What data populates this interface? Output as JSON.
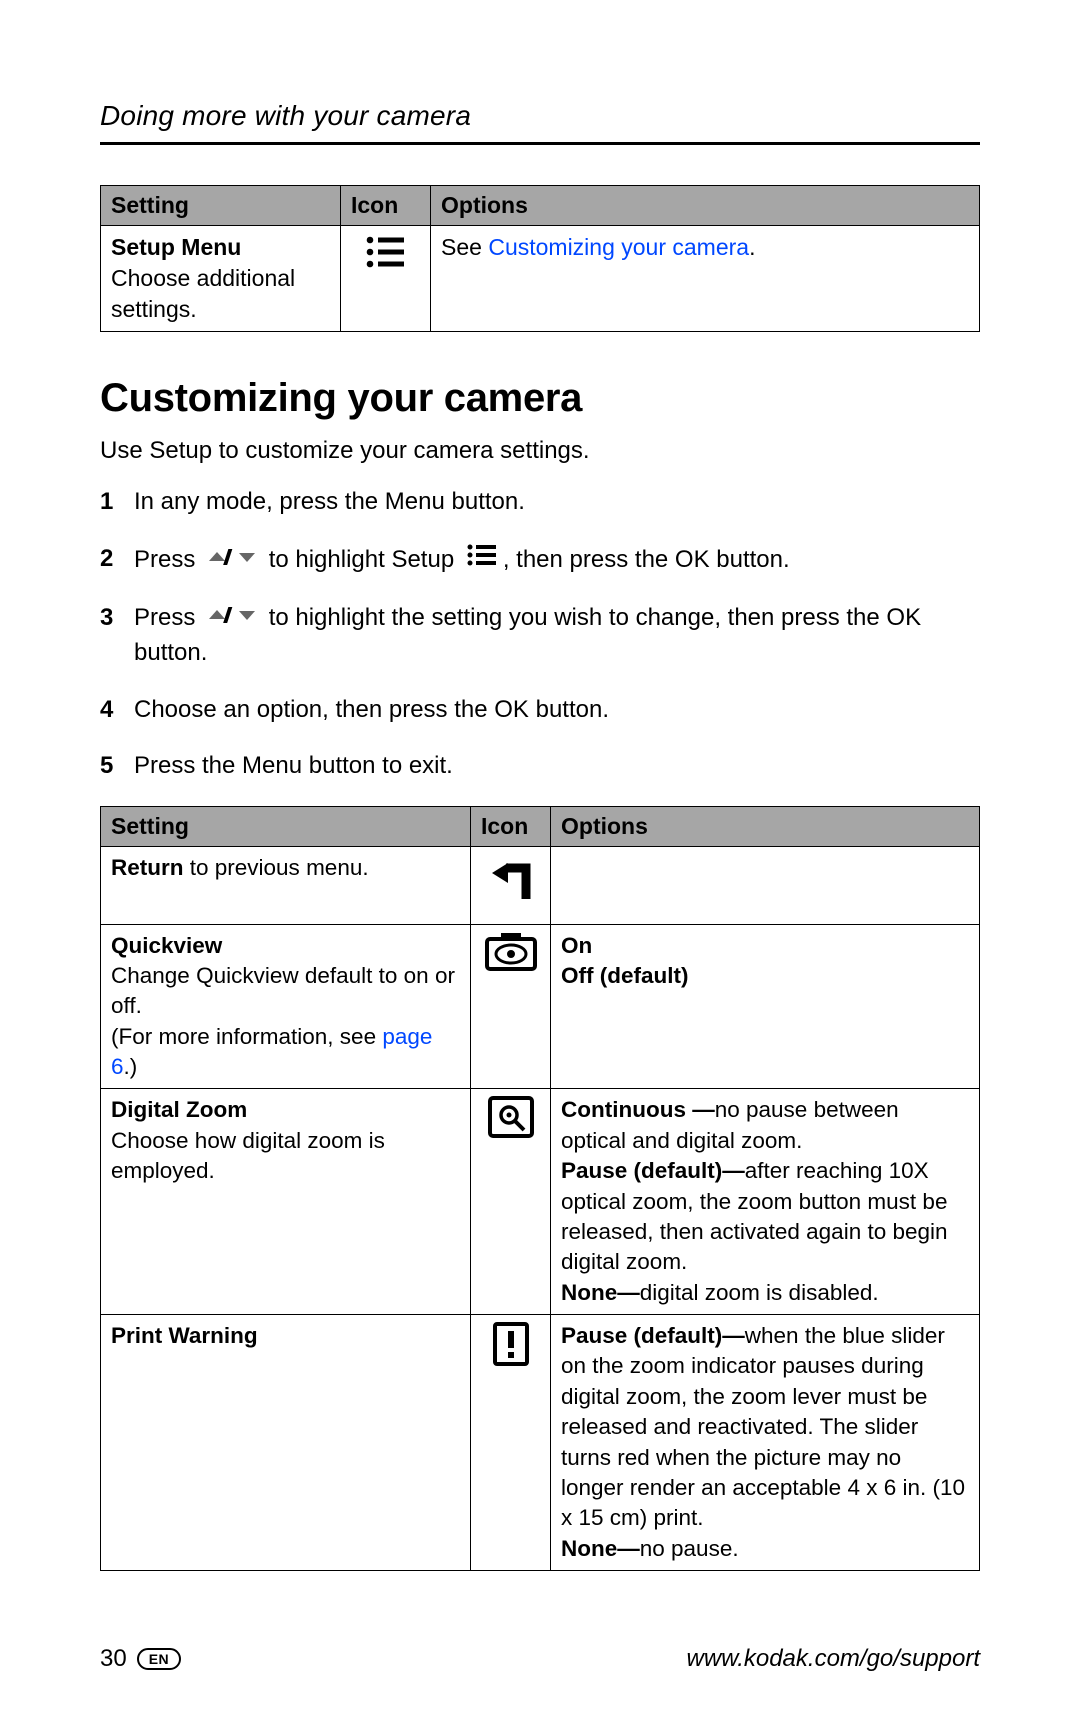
{
  "header": {
    "title": "Doing more with your camera"
  },
  "table1": {
    "headers": {
      "c1": "Setting",
      "c2": "Icon",
      "c3": "Options"
    },
    "row": {
      "settingTitle": "Setup Menu",
      "settingDesc": "Choose additional settings.",
      "optionsPrefix": "See ",
      "optionsLink": "Customizing your camera",
      "optionsSuffix": "."
    }
  },
  "section": {
    "heading": "Customizing your camera",
    "intro": "Use Setup to customize your camera settings.",
    "steps": {
      "s1": "In any mode, press the Menu button.",
      "s2a": "Press ",
      "s2b": " to highlight Setup ",
      "s2c": ", then press the OK button.",
      "s3a": "Press ",
      "s3b": " to highlight the setting you wish to change, then press the OK button.",
      "s4": "Choose an option, then press the OK button.",
      "s5": "Press the Menu button to exit."
    }
  },
  "table2": {
    "headers": {
      "c1": "Setting",
      "c2": "Icon",
      "c3": "Options"
    },
    "rows": {
      "return": {
        "titleBold": "Return",
        "titleRest": " to previous menu."
      },
      "quickview": {
        "title": "Quickview",
        "desc1": "Change Quickview default to on or off.",
        "desc2a": "(For more information, see ",
        "desc2link": "page 6",
        "desc2b": ".)",
        "opt1": "On",
        "opt2": "Off (default)"
      },
      "dz": {
        "title": "Digital Zoom",
        "desc": "Choose how digital zoom is employed.",
        "o1b": "Continuous —",
        "o1r": "no pause between optical and digital zoom.",
        "o2b": "Pause (default)—",
        "o2r": "after reaching 10X optical zoom, the zoom button must be released, then activated again to begin digital zoom.",
        "o3b": "None—",
        "o3r": "digital zoom is disabled."
      },
      "pw": {
        "title": "Print Warning",
        "o1b": "Pause (default)—",
        "o1r": "when the blue slider on the zoom indicator pauses during digital zoom, the zoom lever must be released and reactivated. The slider turns red when the picture may no longer render an acceptable 4 x 6 in. (10 x 15 cm) print.",
        "o2b": "None—",
        "o2r": "no pause."
      }
    }
  },
  "footer": {
    "page": "30",
    "lang": "EN",
    "url": "www.kodak.com/go/support"
  }
}
